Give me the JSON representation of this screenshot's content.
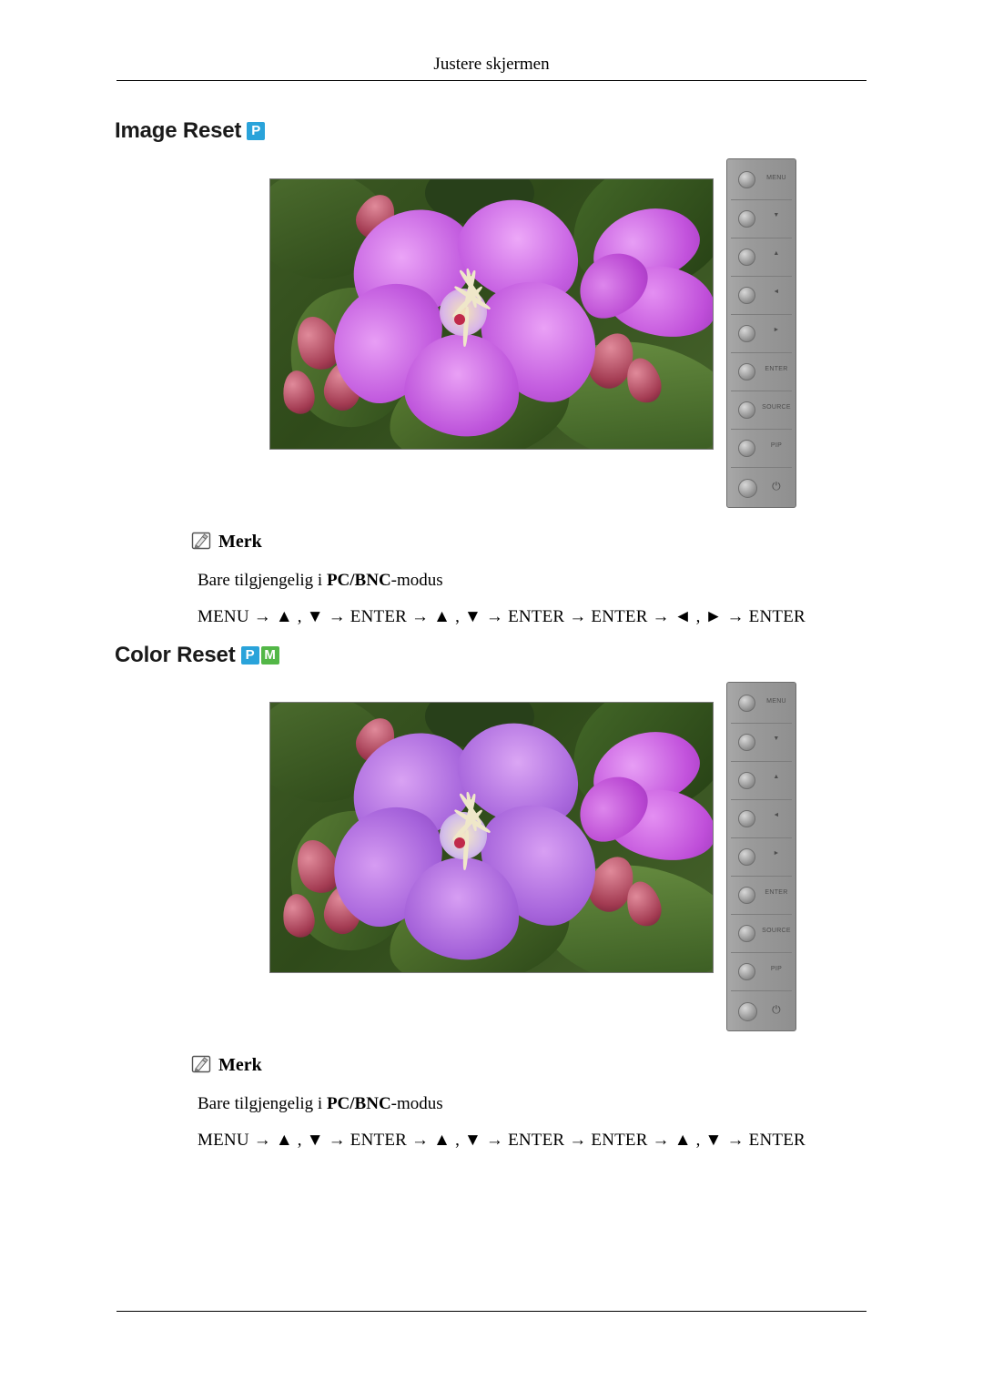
{
  "header": {
    "title": "Justere skjermen"
  },
  "sections": [
    {
      "title": "Image Reset",
      "badges": [
        "P"
      ],
      "note": {
        "label": "Merk",
        "icon": "note-pencil-icon",
        "availability_prefix": "Bare tilgjengelig i ",
        "availability_bold": "PC/BNC",
        "availability_suffix": "-modus",
        "sequence": "MENU → ▲ , ▼ → ENTER → ▲ , ▼ → ENTER → ENTER → ◄ , ► → ENTER"
      }
    },
    {
      "title": "Color Reset",
      "badges": [
        "P",
        "M"
      ],
      "note": {
        "label": "Merk",
        "icon": "note-pencil-icon",
        "availability_prefix": "Bare tilgjengelig i ",
        "availability_bold": "PC/BNC",
        "availability_suffix": "-modus",
        "sequence": "MENU → ▲ , ▼ → ENTER → ▲ , ▼ → ENTER → ENTER → ▲ , ▼ → ENTER"
      }
    }
  ],
  "monitor_panel": {
    "buttons": [
      {
        "name": "menu",
        "label": "MENU"
      },
      {
        "name": "down",
        "label": "▼"
      },
      {
        "name": "up",
        "label": "▲"
      },
      {
        "name": "left",
        "label": "◄"
      },
      {
        "name": "right",
        "label": "►"
      },
      {
        "name": "enter",
        "label": "ENTER"
      },
      {
        "name": "source",
        "label": "SOURCE"
      },
      {
        "name": "pip",
        "label": "PIP"
      },
      {
        "name": "power",
        "label": "⏻"
      }
    ]
  },
  "colors": {
    "badge_p": "#2aa3da",
    "badge_m": "#53b747",
    "panel": "#9a9a9a",
    "flower": "#c45fe0"
  }
}
